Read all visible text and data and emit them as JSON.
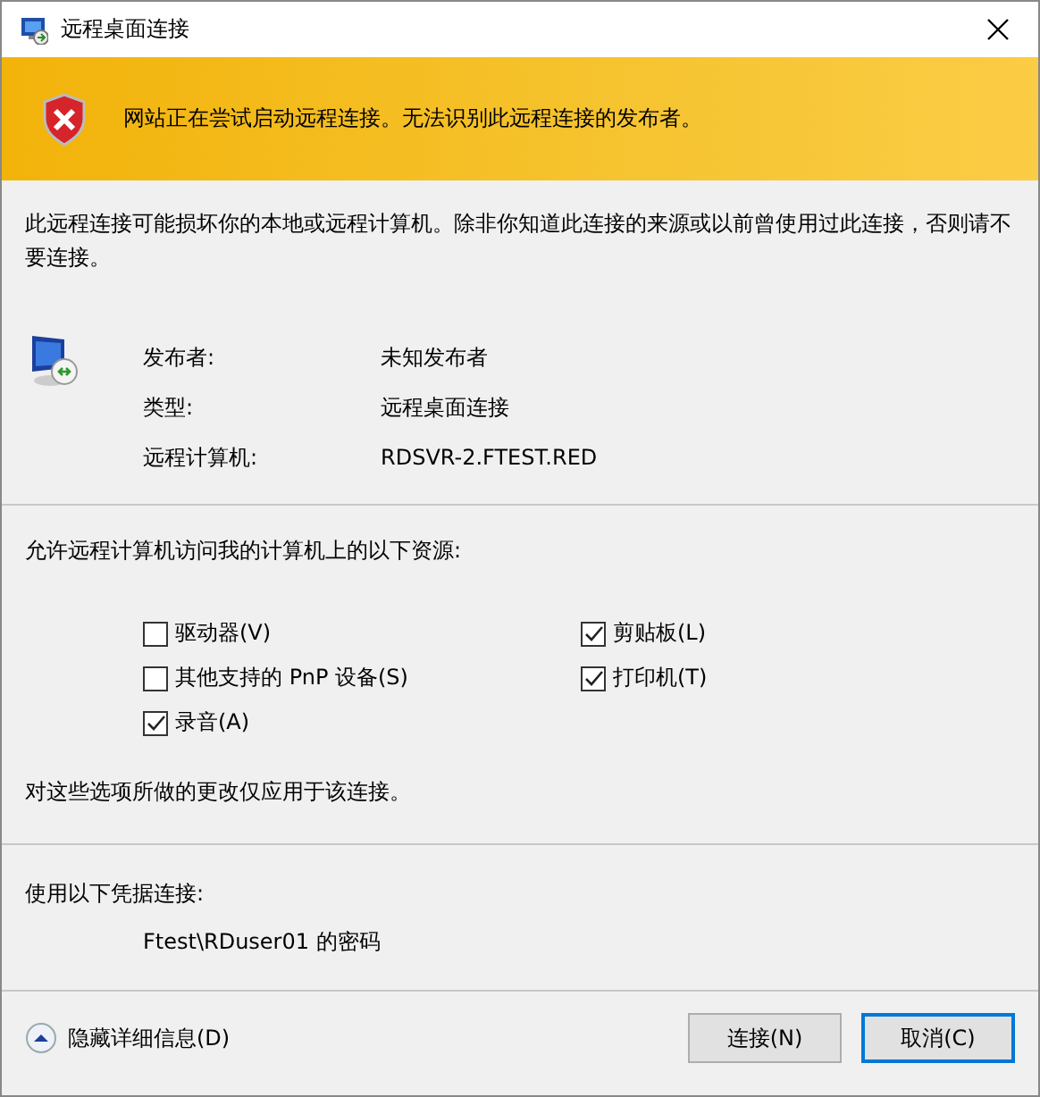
{
  "window": {
    "title": "远程桌面连接"
  },
  "banner": {
    "message": "网站正在尝试启动远程连接。无法识别此远程连接的发布者。"
  },
  "warning": "此远程连接可能损坏你的本地或远程计算机。除非你知道此连接的来源或以前曾使用过此连接，否则请不要连接。",
  "details": [
    {
      "label": "发布者:",
      "value": "未知发布者"
    },
    {
      "label": "类型:",
      "value": "远程桌面连接"
    },
    {
      "label": "远程计算机:",
      "value": "RDSVR-2.FTEST.RED"
    }
  ],
  "resources": {
    "heading": "允许远程计算机访问我的计算机上的以下资源:",
    "options": [
      {
        "label": "驱动器(V)",
        "checked": false
      },
      {
        "label": "剪贴板(L)",
        "checked": true
      },
      {
        "label": "其他支持的 PnP 设备(S)",
        "checked": false
      },
      {
        "label": "打印机(T)",
        "checked": true
      },
      {
        "label": "录音(A)",
        "checked": true
      }
    ],
    "note": "对这些选项所做的更改仅应用于该连接。"
  },
  "credentials": {
    "heading": "使用以下凭据连接:",
    "value": "Ftest\\RDuser01 的密码"
  },
  "details_toggle": {
    "label": "隐藏详细信息(D)",
    "expanded": true
  },
  "buttons": [
    {
      "label": "连接(N)",
      "focused": false
    },
    {
      "label": "取消(C)",
      "focused": true
    }
  ]
}
